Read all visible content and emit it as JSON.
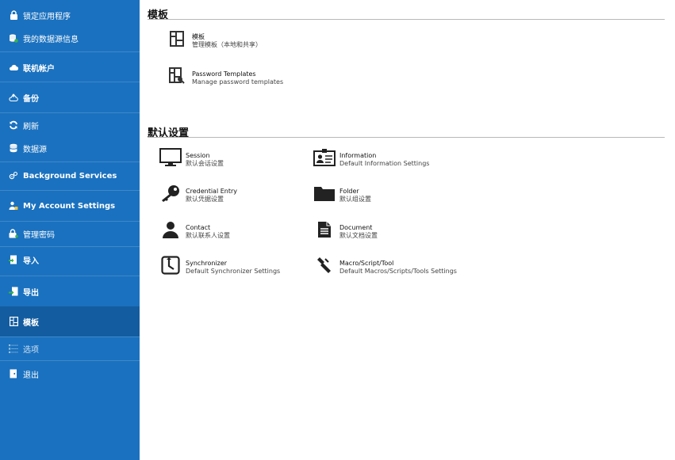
{
  "sidebar": {
    "items": [
      {
        "label": "锁定应用程序",
        "icon": "lock-icon"
      },
      {
        "label": "我的数据源信息",
        "icon": "datasource-info-icon"
      },
      {
        "label": "联机帐户",
        "icon": "cloud-icon"
      },
      {
        "label": "备份",
        "icon": "backup-icon"
      },
      {
        "label": "刷新",
        "icon": "refresh-icon"
      },
      {
        "label": "数据源",
        "icon": "datasource-icon"
      },
      {
        "label": "Background Services",
        "icon": "services-icon"
      },
      {
        "label": "My Account Settings",
        "icon": "account-icon"
      },
      {
        "label": "管理密码",
        "icon": "key-lock-icon"
      },
      {
        "label": "导入",
        "icon": "import-icon"
      },
      {
        "label": "导出",
        "icon": "export-icon"
      },
      {
        "label": "模板",
        "icon": "template-icon"
      },
      {
        "label": "选项",
        "icon": "options-icon"
      },
      {
        "label": "退出",
        "icon": "exit-icon"
      }
    ],
    "active_item": "模板",
    "colors": {
      "background": "#1a71bf",
      "active": "#135c9f"
    }
  },
  "main": {
    "templates_section": {
      "title": "模板",
      "tiles": [
        {
          "title": "模板",
          "subtitle": "管理模板（本地和共享）",
          "icon": "template-icon"
        },
        {
          "title": "Password Templates",
          "subtitle": "Manage password templates",
          "icon": "password-template-icon"
        }
      ]
    },
    "defaults_section": {
      "title": "默认设置",
      "tiles": [
        {
          "title": "Session",
          "subtitle": "默认会话设置",
          "icon": "monitor-icon"
        },
        {
          "title": "Information",
          "subtitle": "Default Information Settings",
          "icon": "id-card-icon"
        },
        {
          "title": "Credential Entry",
          "subtitle": "默认凭据设置",
          "icon": "key-icon"
        },
        {
          "title": "Folder",
          "subtitle": "默认组设置",
          "icon": "folder-icon"
        },
        {
          "title": "Contact",
          "subtitle": "默认联系人设置",
          "icon": "contact-icon"
        },
        {
          "title": "Document",
          "subtitle": "默认文档设置",
          "icon": "document-icon"
        },
        {
          "title": "Synchronizer",
          "subtitle": "Default Synchronizer Settings",
          "icon": "synchronizer-icon"
        },
        {
          "title": "Macro/Script/Tool",
          "subtitle": "Default Macros/Scripts/Tools Settings",
          "icon": "macro-icon"
        }
      ]
    }
  }
}
